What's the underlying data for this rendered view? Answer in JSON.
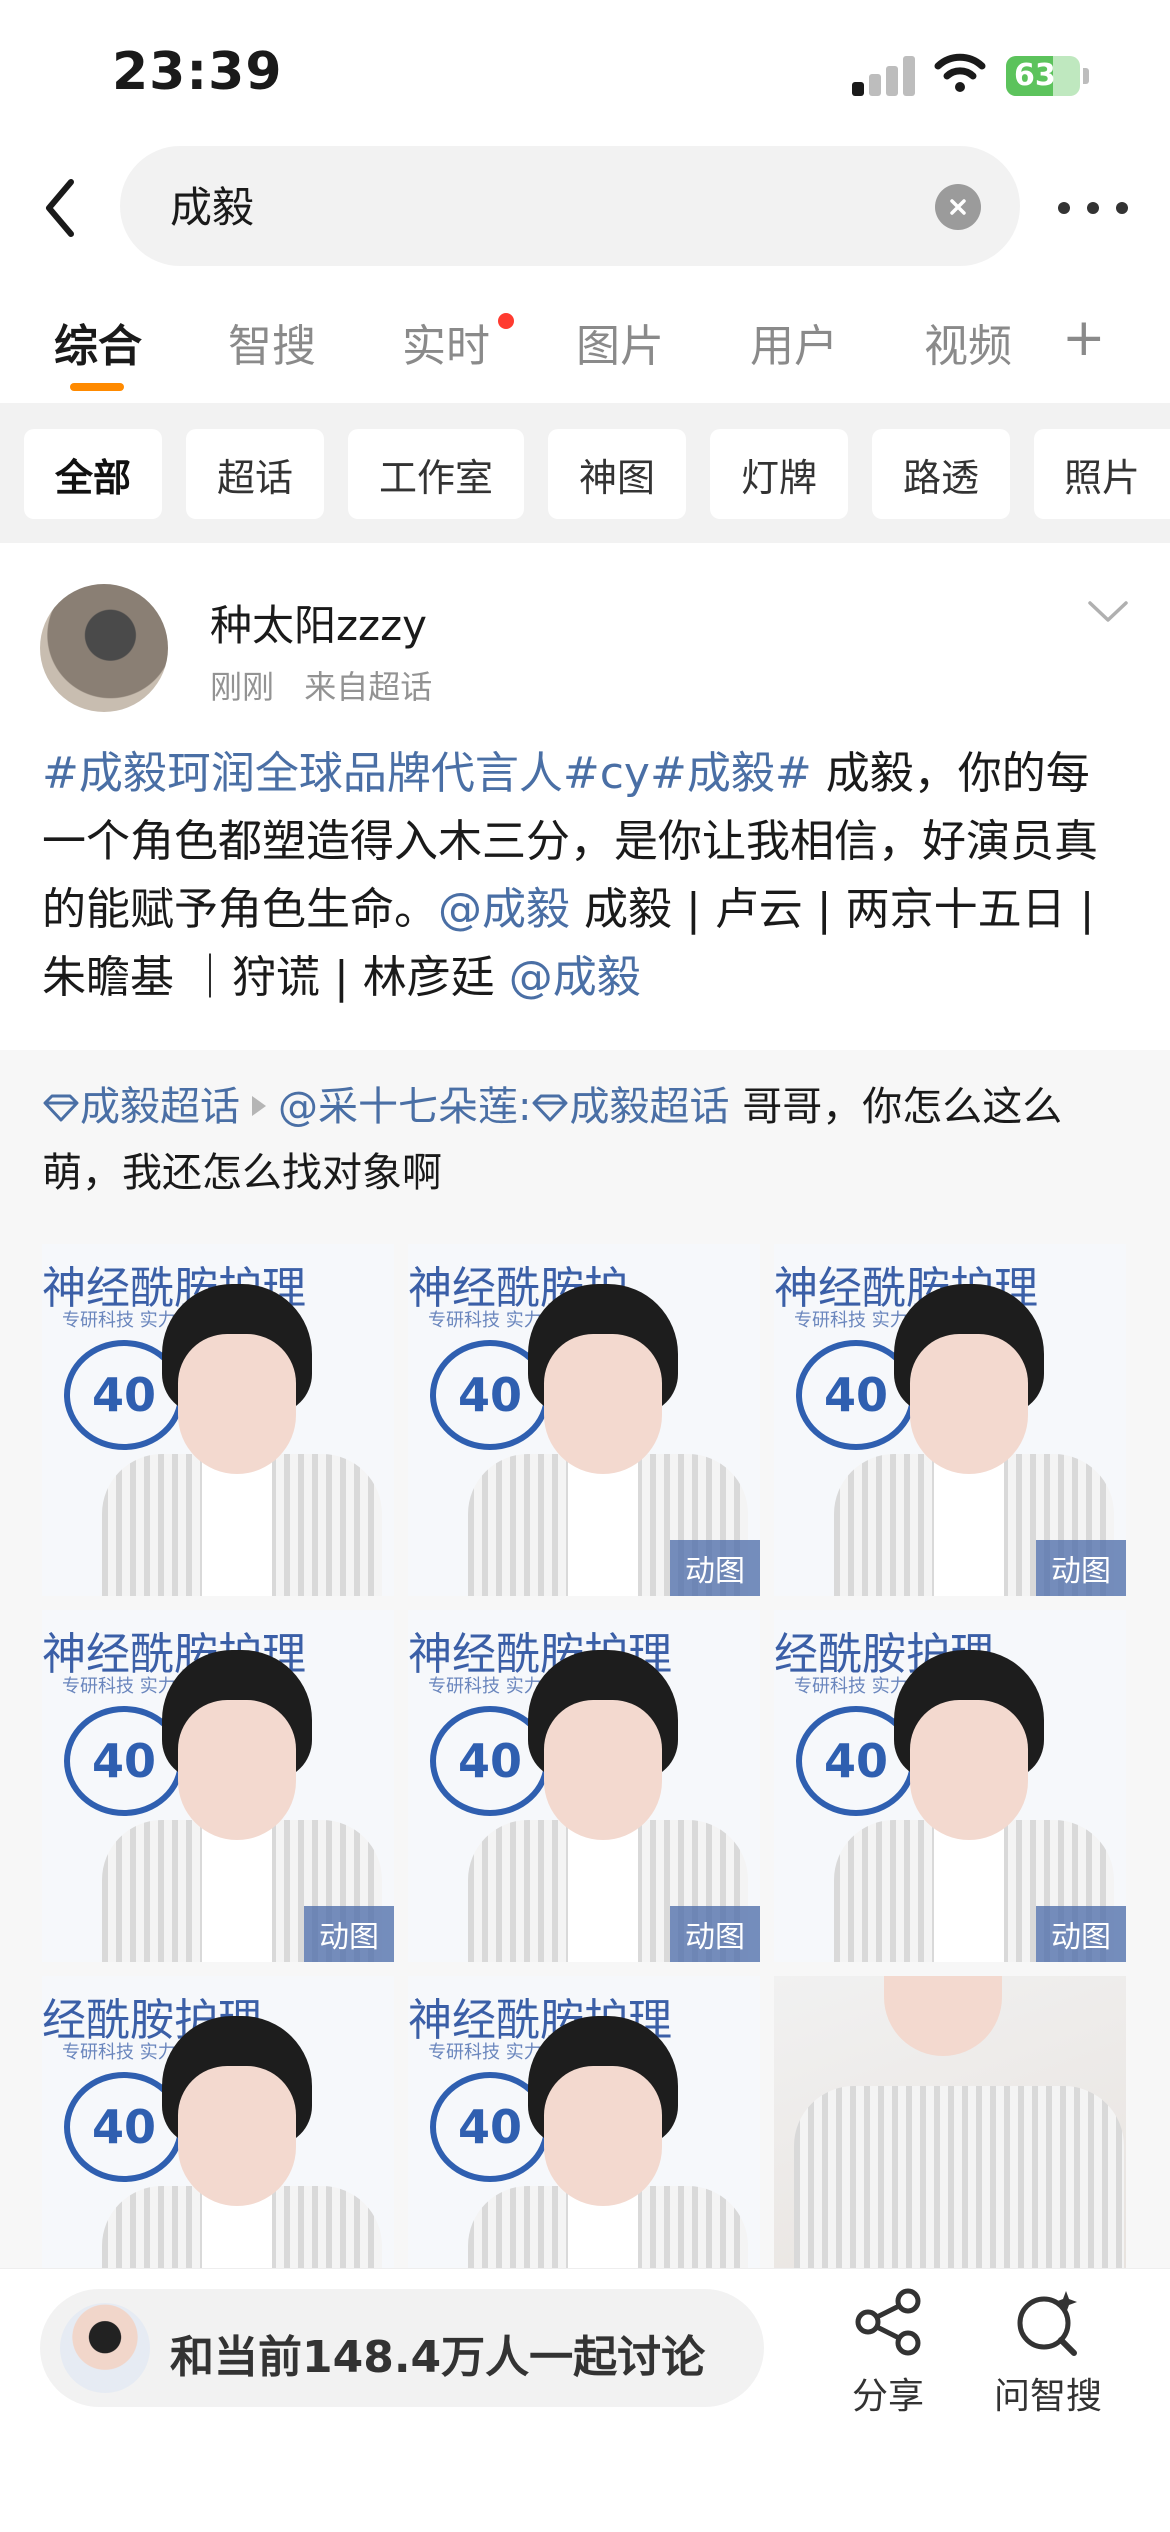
{
  "status_bar": {
    "time": "23:39",
    "battery": "63",
    "battery_level": 0.63
  },
  "search": {
    "query": "成毅"
  },
  "tabs": [
    {
      "label": "综合",
      "active": true
    },
    {
      "label": "智搜"
    },
    {
      "label": "实时",
      "dot": true
    },
    {
      "label": "图片"
    },
    {
      "label": "用户"
    },
    {
      "label": "视频"
    }
  ],
  "tab_more": "+",
  "chips": [
    "全部",
    "超话",
    "工作室",
    "神图",
    "灯牌",
    "路透",
    "照片"
  ],
  "post": {
    "username": "种太阳zzzy",
    "time": "刚刚",
    "source": "来自超话",
    "tag1": "#成毅珂润全球品牌代言人#",
    "tag2": "cy",
    "tag3": "#成毅#",
    "text1": " 成毅，你的每一个角色都塑造得入木三分，是你让我相信，好演员真的能赋予角色生命。",
    "mention1": "@成毅",
    "text2": " 成毅 | 卢云 | 两京十五日 | 朱瞻基 ｜狩谎 | 林彦廷 ",
    "mention2": "@成毅"
  },
  "repost": {
    "topic": "成毅超话",
    "user": "@采十七朵莲",
    "sep": ":",
    "topic2": "成毅超话",
    "text": " 哥哥，你怎么这么萌，我还怎么找对象啊"
  },
  "images": [
    {
      "bg": "神经酰胺护理",
      "gif": false
    },
    {
      "bg": "神经酰胺护",
      "gif": true,
      "gif_label": "动图"
    },
    {
      "bg": "神经酰胺护理",
      "gif": true,
      "gif_label": "动图"
    },
    {
      "bg": "神经酰胺护理",
      "gif": true,
      "gif_label": "动图"
    },
    {
      "bg": "神经酰胺护理",
      "gif": true,
      "gif_label": "动图"
    },
    {
      "bg": "经酰胺护理",
      "gif": true,
      "gif_label": "动图"
    },
    {
      "bg": "经酰胺护理",
      "gif": false
    },
    {
      "bg": "神经酰胺护理",
      "gif": false
    },
    {
      "bg": "",
      "gif": false
    }
  ],
  "image_sub": "专研科技 实力修护",
  "image_badge": "40",
  "bottom": {
    "discuss": "和当前148.4万人一起讨论",
    "share": "分享",
    "ask": "问智搜"
  },
  "colors": {
    "accent": "#ff8a00",
    "link": "#4a6fa5",
    "badge_dot": "#ff3b30"
  },
  "icons": [
    "back-arrow-icon",
    "clear-icon",
    "more-icon",
    "chevron-down-icon",
    "diamond-icon",
    "share-icon",
    "ai-search-icon",
    "wifi-icon",
    "signal-icon",
    "battery-icon"
  ]
}
